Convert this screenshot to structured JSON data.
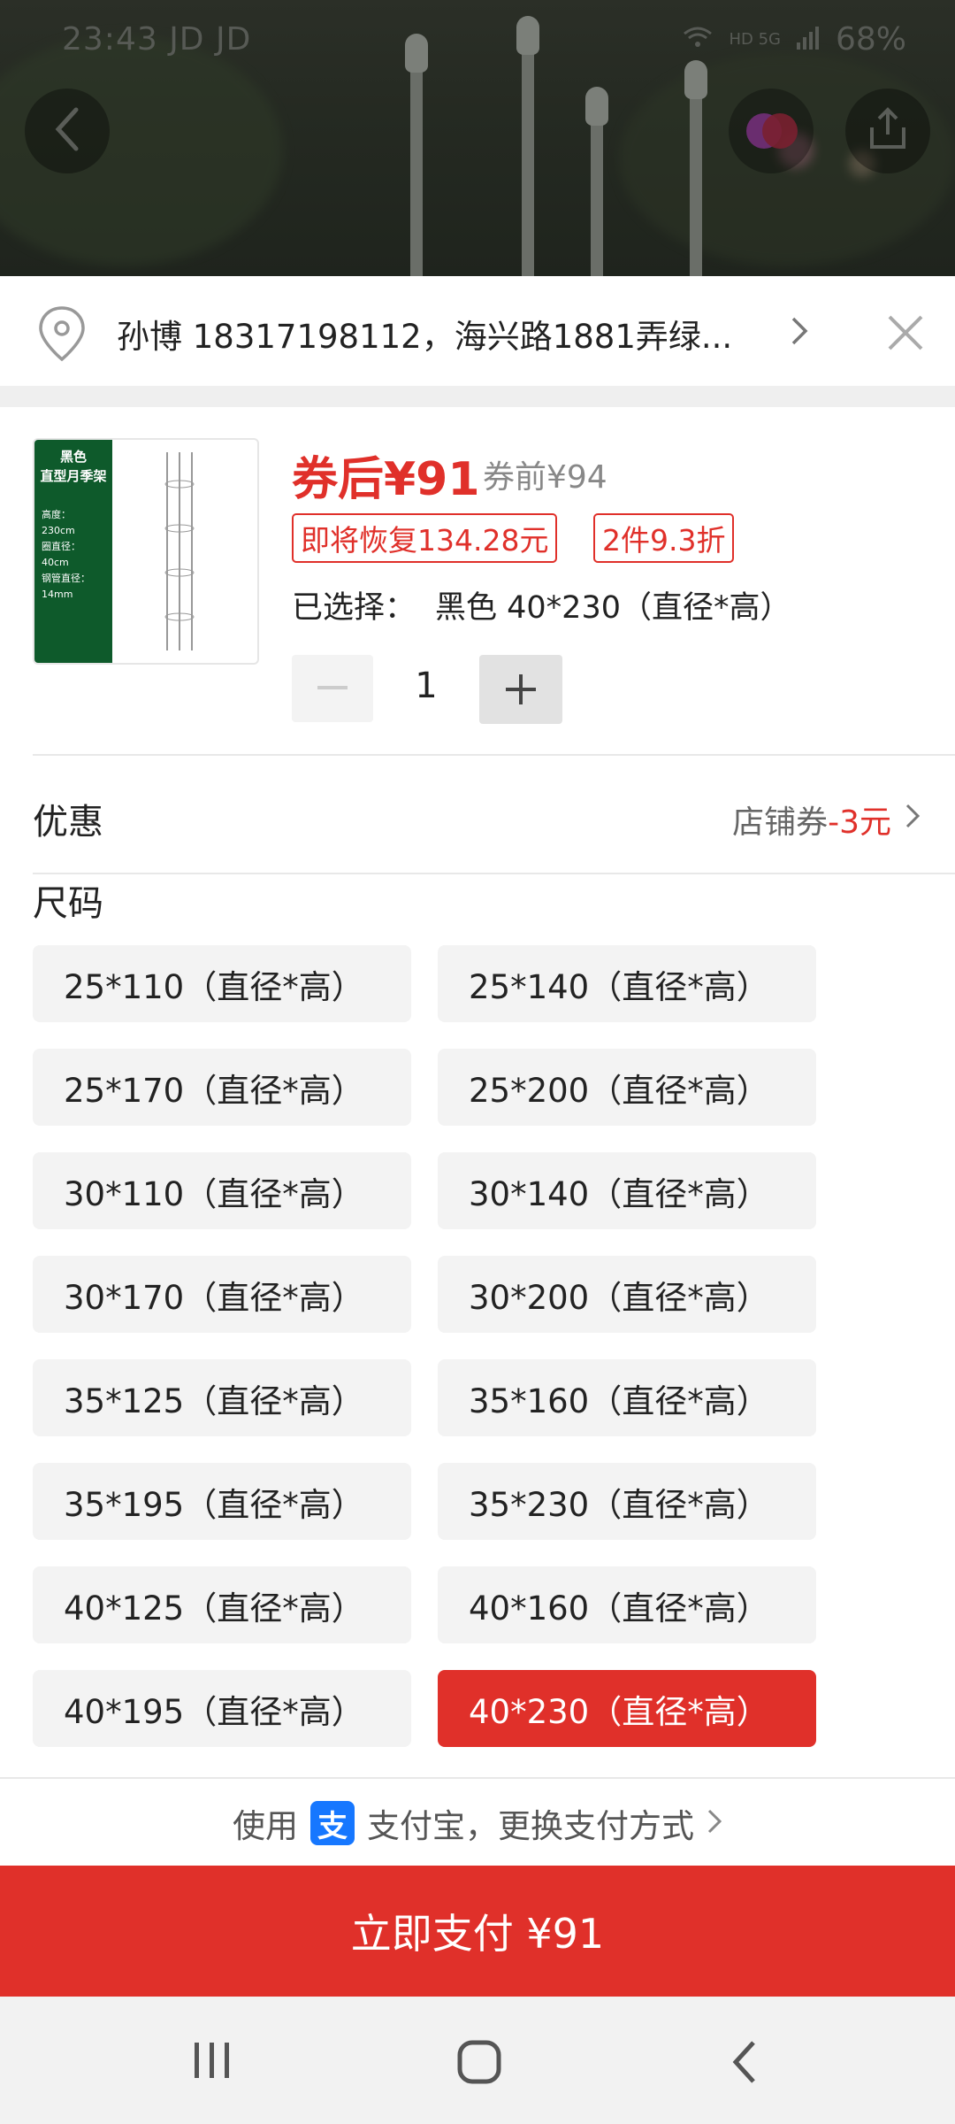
{
  "status_bar": {
    "time_carrier": "23:43 JD JD",
    "right_text": "HD 5G",
    "battery": "68%"
  },
  "address": {
    "text": "孙博 18317198112，海兴路1881弄绿..."
  },
  "product": {
    "image_title": "黑色\n直型月季架",
    "image_specs": "高度：\n230cm\n圈直径：\n40cm\n钢管直径：\n14mm",
    "price_after_coupon": "券后¥91",
    "price_before_coupon": "券前¥94",
    "tag_restore": "即将恢复134.28元",
    "tag_discount": "2件9.3折",
    "selected_label": "已选择：",
    "selected_value": "黑色 40*230（直径*高）",
    "quantity": "1",
    "minus_symbol": "−",
    "plus_symbol": "+"
  },
  "promo": {
    "label": "优惠",
    "value_prefix": "店铺券",
    "value_amount": "-3元"
  },
  "sizes": {
    "label": "尺码",
    "selected": "40*230（直径*高）",
    "options": [
      "25*110（直径*高）",
      "25*140（直径*高）",
      "25*170（直径*高）",
      "25*200（直径*高）",
      "30*110（直径*高）",
      "30*140（直径*高）",
      "30*170（直径*高）",
      "30*200（直径*高）",
      "35*125（直径*高）",
      "35*160（直径*高）",
      "35*195（直径*高）",
      "35*230（直径*高）",
      "40*125（直径*高）",
      "40*160（直径*高）",
      "40*195（直径*高）",
      "40*230（直径*高）"
    ]
  },
  "payment": {
    "prefix": "使用",
    "alipay_glyph": "支",
    "text": "支付宝，更换支付方式",
    "button": "立即支付 ¥91"
  },
  "colors": {
    "accent": "#e0302a",
    "alipay": "#1677ff"
  }
}
